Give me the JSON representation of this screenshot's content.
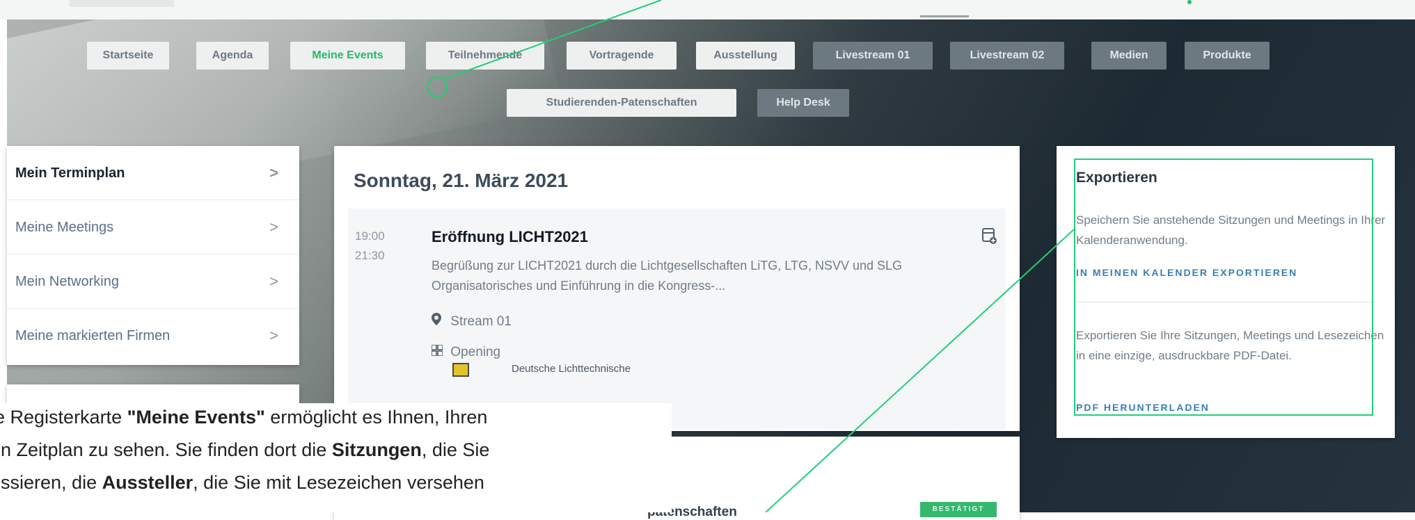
{
  "nav": {
    "tabs": [
      {
        "label": "Startseite"
      },
      {
        "label": "Agenda"
      },
      {
        "label": "Meine Events",
        "active": true
      },
      {
        "label": "Teilnehmende"
      },
      {
        "label": "Vortragende"
      },
      {
        "label": "Ausstellung"
      },
      {
        "label": "Livestream 01"
      },
      {
        "label": "Livestream 02"
      },
      {
        "label": "Medien"
      },
      {
        "label": "Produkte"
      }
    ],
    "tabs_row2": [
      {
        "label": "Studierenden-Patenschaften"
      },
      {
        "label": "Help Desk"
      }
    ]
  },
  "sidebar": {
    "items": [
      {
        "label": "Mein Terminplan"
      },
      {
        "label": "Meine Meetings"
      },
      {
        "label": "Mein Networking"
      },
      {
        "label": "Meine markierten Firmen"
      }
    ],
    "chevron": ">"
  },
  "agenda": {
    "date": "Sonntag, 21. März 2021",
    "session": {
      "start": "19:00",
      "end": "21:30",
      "title": "Eröffnung LICHT2021",
      "description": "Begrüßung zur LICHT2021 durch die Lichtgesellschaften LiTG, LTG, NSVV und SLG       Organisatorisches und Einführung in die Kongress-...",
      "location": "Stream 01",
      "type": "Opening",
      "sponsor": "Deutsche Lichttechnische"
    }
  },
  "export": {
    "title": "Exportieren",
    "calendar_text": "Speichern Sie anstehende Sitzungen und Meetings in Ihrer Kalenderanwendung.",
    "calendar_link": "IN MEINEN KALENDER EXPORTIEREN",
    "pdf_text": "Exportieren Sie Ihre Sitzungen, Meetings und Lesezeichen in eine einzige, ausdruckbare PDF-Datei.",
    "pdf_link": "PDF HERUNTERLADEN"
  },
  "bottom": {
    "title_fragment": "patenschaften",
    "badge": "BESTÄTIGT"
  },
  "caption": {
    "l1_a": "ie Registerkarte ",
    "l1_b": "\"Meine Events\"",
    "l1_c": " ermöglicht es Ihnen, Ihren",
    "l2_a": "en Zeitplan zu sehen. Sie finden dort die ",
    "l2_b": "Sitzungen",
    "l2_c": ", die Sie",
    "l3_a": "essieren, die ",
    "l3_b": "Aussteller",
    "l3_c": ", die Sie mit Lesezeichen versehen"
  },
  "colors": {
    "accent": "#26b96c",
    "callout": "#1fcf78",
    "link": "#3b7fb0"
  }
}
